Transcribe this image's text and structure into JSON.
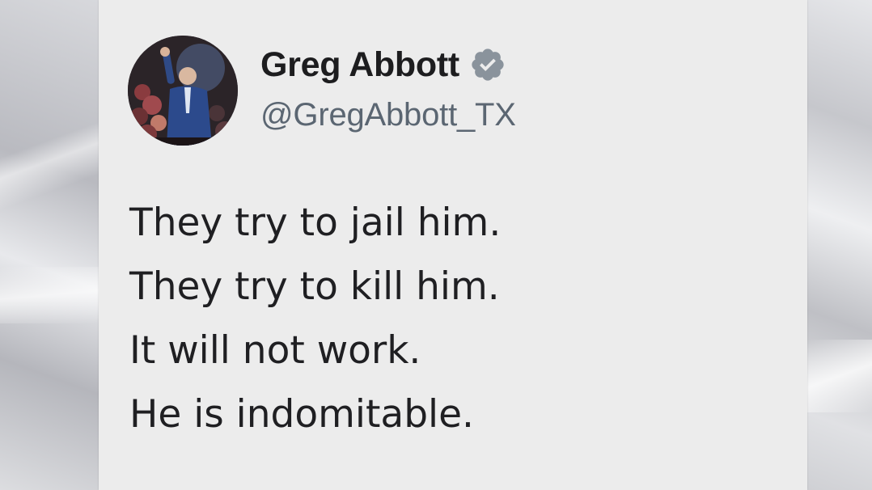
{
  "tweet": {
    "author": {
      "display_name": "Greg Abbott",
      "handle": "@GregAbbott_TX",
      "verified": true,
      "avatar_icon": "profile-photo"
    },
    "lines": [
      "They try to jail him.",
      "They try to kill him.",
      "It will not work.",
      "He is indomitable."
    ]
  },
  "colors": {
    "card_background": "#ececec",
    "name_text": "#1d1d1f",
    "handle_text": "#5b6672",
    "body_text": "#1f1f22",
    "verified_badge": "#8a939c"
  }
}
